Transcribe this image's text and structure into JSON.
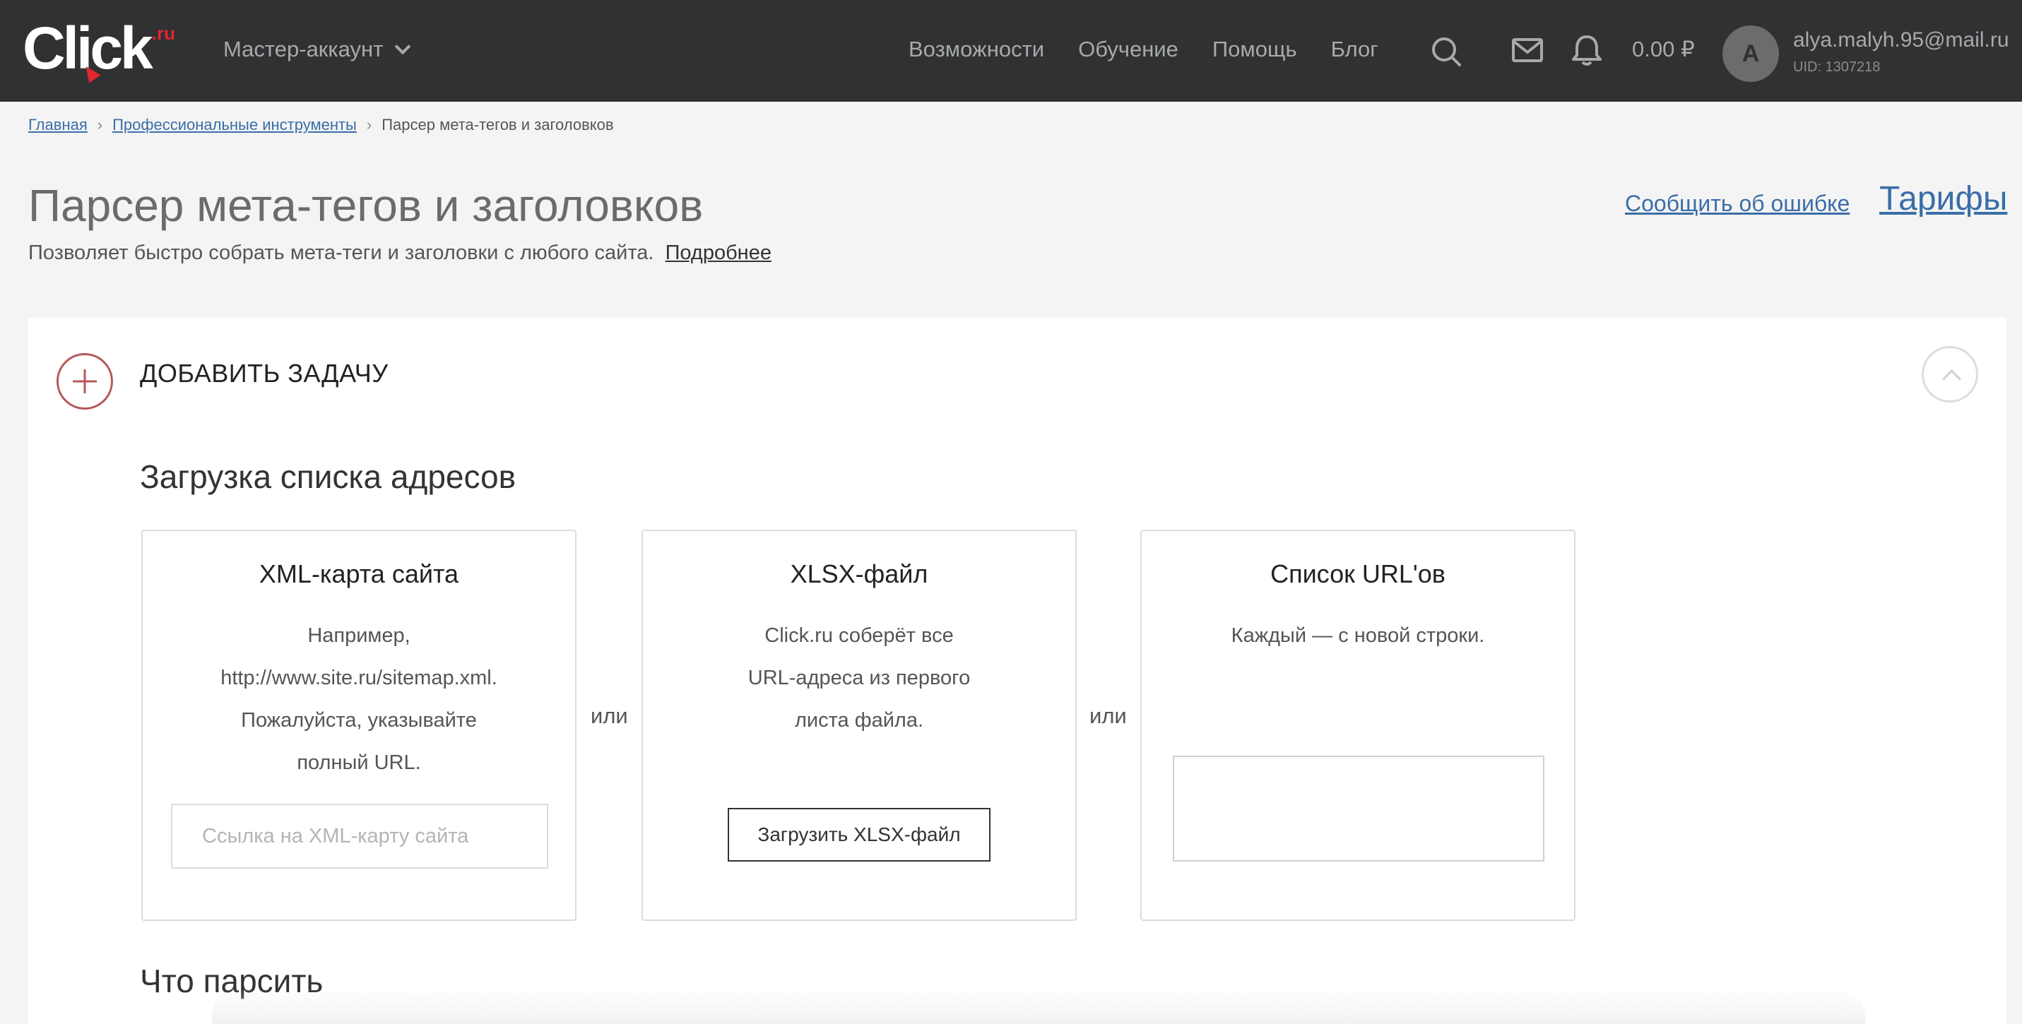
{
  "header": {
    "logo_text": "Click",
    "logo_suffix": ".ru",
    "account_switch": "Мастер-аккаунт",
    "nav": [
      {
        "label": "Возможности"
      },
      {
        "label": "Обучение"
      },
      {
        "label": "Помощь"
      },
      {
        "label": "Блог"
      }
    ],
    "balance": "0.00 ₽",
    "avatar_letter": "A",
    "user_email": "alya.malyh.95@mail.ru",
    "user_uid": "UID: 1307218"
  },
  "breadcrumb": {
    "items": [
      "Главная",
      "Профессиональные инструменты"
    ],
    "current": "Парсер мета-тегов и заголовков",
    "separator": "›"
  },
  "page": {
    "title": "Парсер мета-тегов и заголовков",
    "subtitle": "Позволяет быстро собрать мета-теги и заголовки с любого сайта.",
    "more_link": "Подробнее",
    "report_link": "Сообщить об ошибке",
    "tariffs_link": "Тарифы"
  },
  "task": {
    "add_title": "ДОБАВИТЬ ЗАДАЧУ",
    "upload_section_title": "Загрузка списка адресов",
    "or_label": "или",
    "cards": [
      {
        "title": "XML-карта сайта",
        "desc": [
          "Например,",
          "http://www.site.ru/sitemap.xml.",
          "Пожалуйста, указывайте",
          "полный URL."
        ],
        "input_placeholder": "Ссылка на XML-карту сайта"
      },
      {
        "title": "XLSX-файл",
        "desc": [
          "Click.ru соберёт все",
          "URL-адреса из первого",
          "листа файла."
        ],
        "button_label": "Загрузить XLSX-файл"
      },
      {
        "title": "Список URL'ов",
        "desc": [
          "Каждый — с новой строки."
        ],
        "textarea_value": ""
      }
    ],
    "parse_section_title": "Что парсить"
  },
  "colors": {
    "header_bg": "#2f3133",
    "link": "#3a6ea8",
    "accent": "#e1262d",
    "add_circle": "#b5585b"
  }
}
